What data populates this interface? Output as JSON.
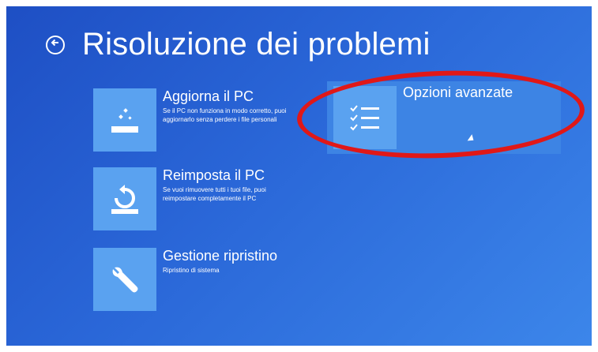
{
  "header": {
    "title": "Risoluzione dei problemi",
    "back_icon": "arrow-left-icon"
  },
  "tiles": [
    {
      "title": "Aggiorna il PC",
      "description": "Se il PC non funziona in modo corretto, puoi aggiornarlo senza perdere i file personali",
      "icon": "refresh-sparkle-icon"
    },
    {
      "title": "Reimposta il PC",
      "description": "Se vuoi rimuovere tutti i tuoi file, puoi reimpostare completamente il PC",
      "icon": "reset-icon"
    },
    {
      "title": "Gestione ripristino",
      "description": "Ripristino di sistema",
      "icon": "wrench-icon"
    }
  ],
  "advanced": {
    "title": "Opzioni avanzate",
    "icon": "checklist-icon"
  },
  "colors": {
    "background": "#2a67d8",
    "tile": "#5aa2f0",
    "highlight": "#e01818"
  }
}
